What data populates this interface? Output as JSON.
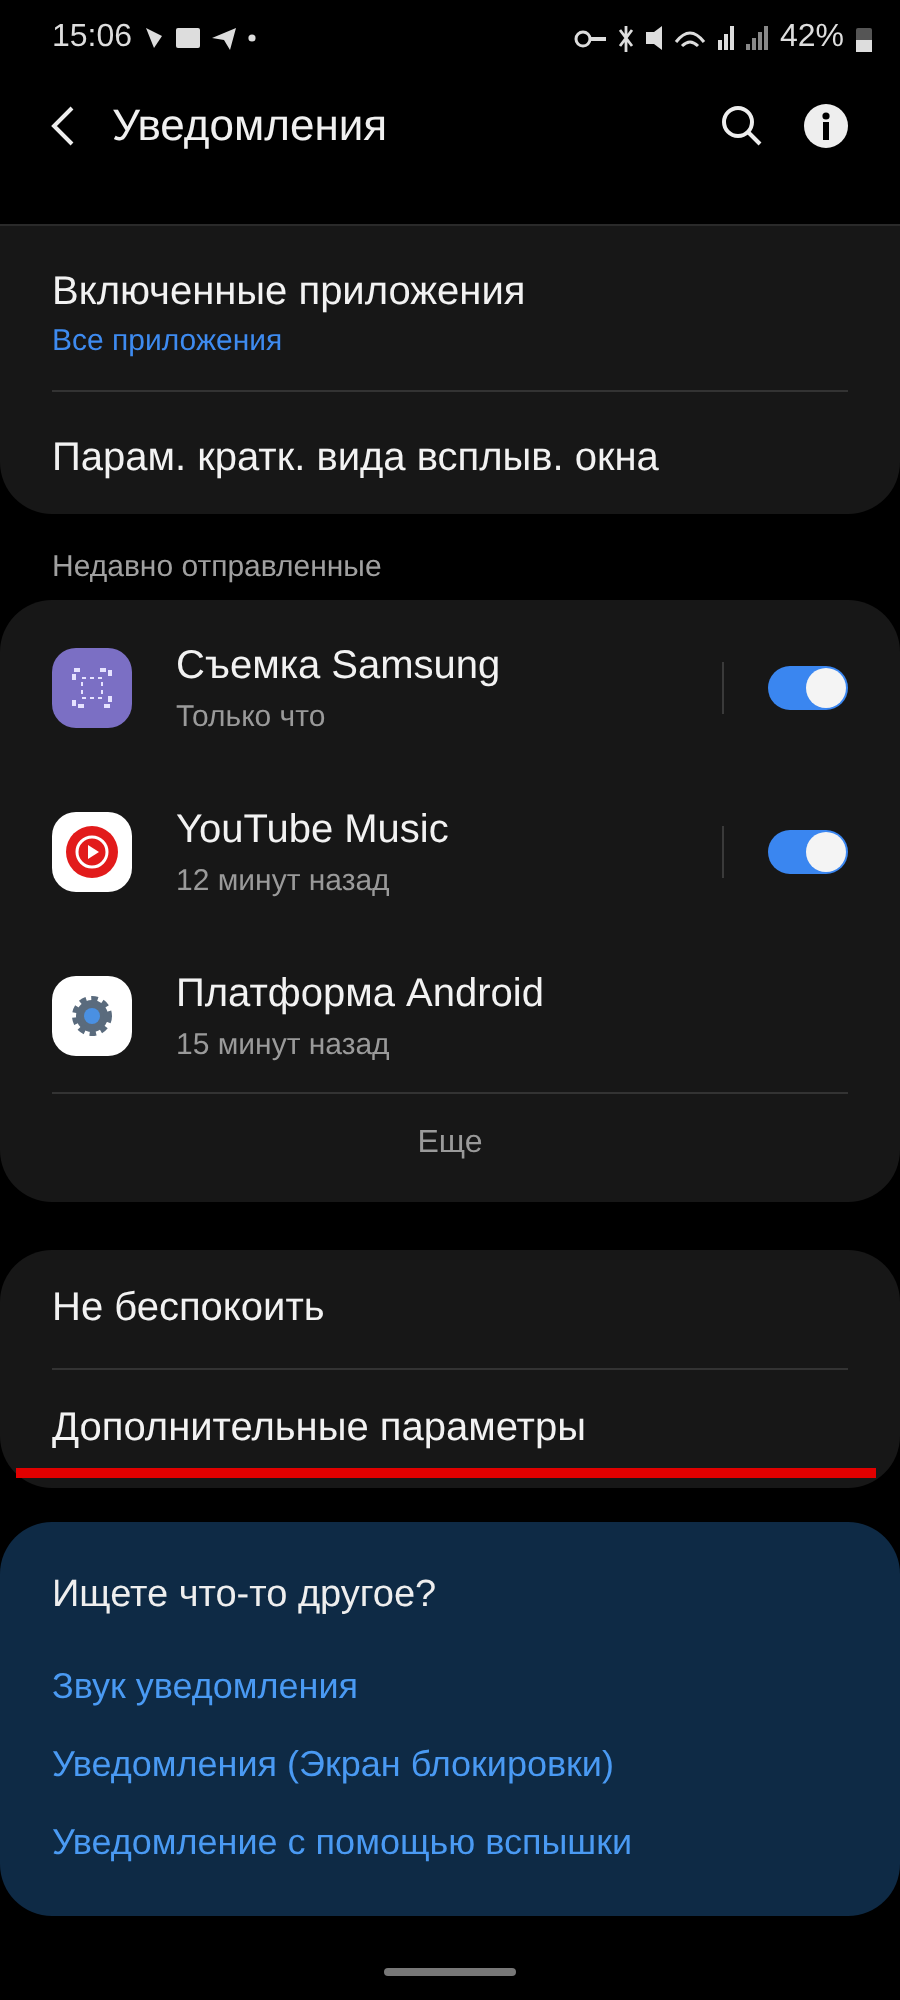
{
  "status_bar": {
    "time": "15:06",
    "battery": "42%"
  },
  "header": {
    "title": "Уведомления"
  },
  "top_card": [
    {
      "label": "Включенные приложения",
      "sublabel": "Все приложения"
    },
    {
      "label": "Парам. кратк. вида всплыв. окна"
    }
  ],
  "recent": {
    "heading": "Недавно отправленные",
    "apps": [
      {
        "name": "Съемка Samsung",
        "time": "Только что",
        "kind": "capture",
        "on": true
      },
      {
        "name": "YouTube Music",
        "time": "12 минут назад",
        "kind": "music",
        "on": true
      },
      {
        "name": "Платформа Android",
        "time": "15 минут назад",
        "kind": "system"
      }
    ],
    "more": "Еще"
  },
  "settings": [
    {
      "label": "Не беспокоить",
      "highlighted": false
    },
    {
      "label": "Дополнительные параметры",
      "highlighted": true
    }
  ],
  "suggestions": {
    "heading": "Ищете что-то другое?",
    "links": [
      "Звук уведомления",
      "Уведомления (Экран блокировки)",
      "Уведомление с помощью вспышки"
    ]
  }
}
